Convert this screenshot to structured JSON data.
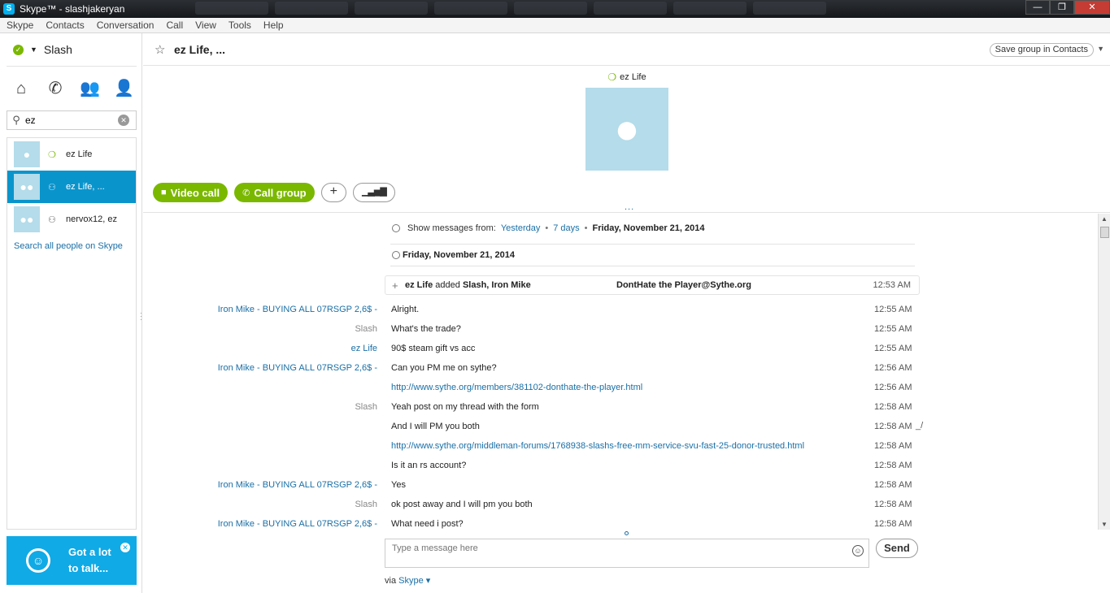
{
  "window": {
    "title": "Skype™ - slashjakeryan",
    "minimize": "—",
    "restore": "❐",
    "close": "✕"
  },
  "menu": [
    "Skype",
    "Contacts",
    "Conversation",
    "Call",
    "View",
    "Tools",
    "Help"
  ],
  "sidebar": {
    "user_name": "Slash",
    "search_value": "ez",
    "contacts": [
      {
        "name": "ez Life",
        "status_icon": "online-leaf-icon",
        "type": "person",
        "selected": false
      },
      {
        "name": "ez Life, ...",
        "status_icon": "group-icon",
        "type": "group",
        "selected": true
      },
      {
        "name": "nervox12, ez",
        "status_icon": "group-icon",
        "type": "group",
        "selected": false
      }
    ],
    "search_all": "Search all people on Skype",
    "ad": {
      "text_line1": "Got a lot",
      "text_line2": "to talk..."
    }
  },
  "conversation": {
    "title": "ez Life, ...",
    "save_group": "Save group in Contacts",
    "profile_name": "ez Life",
    "actions": {
      "video_call": "Video call",
      "call_group": "Call group",
      "add": "+",
      "call_quality": "▁▃▅▇"
    },
    "more": "...",
    "filter": {
      "label": "Show messages from:",
      "yesterday": "Yesterday",
      "seven_days": "7 days",
      "date": "Friday, November 21, 2014"
    },
    "day_header": "Friday, November 21, 2014",
    "event": {
      "actor": "ez Life",
      "verb": "added",
      "targets": "Slash, Iron Mike",
      "group_name": "DontHate the Player@Sythe.org",
      "time": "12:53 AM"
    },
    "messages": [
      {
        "sender": "Iron Mike - BUYING ALL 07RSGP 2,6$ -",
        "sender_style": "blue",
        "text": "Alright.",
        "link": false,
        "time": "12:55 AM",
        "edited": ""
      },
      {
        "sender": "Slash",
        "sender_style": "grey",
        "text": "What's the trade?",
        "link": false,
        "time": "12:55 AM",
        "edited": ""
      },
      {
        "sender": "ez Life",
        "sender_style": "blue",
        "text": "90$ steam gift vs acc",
        "link": false,
        "time": "12:55 AM",
        "edited": ""
      },
      {
        "sender": "Iron Mike - BUYING ALL 07RSGP 2,6$ -",
        "sender_style": "blue",
        "text": "Can you PM me on sythe?",
        "link": false,
        "time": "12:56 AM",
        "edited": ""
      },
      {
        "sender": "",
        "sender_style": "blue",
        "text": "http://www.sythe.org/members/381102-donthate-the-player.html",
        "link": true,
        "time": "12:56 AM",
        "edited": ""
      },
      {
        "sender": "Slash",
        "sender_style": "grey",
        "text": "Yeah post on my thread with the form",
        "link": false,
        "time": "12:58 AM",
        "edited": ""
      },
      {
        "sender": "",
        "sender_style": "grey",
        "text": "And I will PM you both",
        "link": false,
        "time": "12:58 AM",
        "edited": "_/"
      },
      {
        "sender": "",
        "sender_style": "grey",
        "text": "http://www.sythe.org/middleman-forums/1768938-slashs-free-mm-service-svu-fast-25-donor-trusted.html",
        "link": true,
        "time": "12:58 AM",
        "edited": ""
      },
      {
        "sender": "",
        "sender_style": "grey",
        "text": "Is it an rs account?",
        "link": false,
        "time": "12:58 AM",
        "edited": ""
      },
      {
        "sender": "Iron Mike - BUYING ALL 07RSGP 2,6$ -",
        "sender_style": "blue",
        "text": "Yes",
        "link": false,
        "time": "12:58 AM",
        "edited": ""
      },
      {
        "sender": "Slash",
        "sender_style": "grey",
        "text": "ok post away and I will pm you both",
        "link": false,
        "time": "12:58 AM",
        "edited": ""
      },
      {
        "sender": "Iron Mike - BUYING ALL 07RSGP 2,6$ -",
        "sender_style": "blue",
        "text": "What need i post?",
        "link": false,
        "time": "12:58 AM",
        "edited": ""
      }
    ],
    "compose_placeholder": "Type a message here",
    "send": "Send",
    "via_label": "via",
    "via_link": "Skype"
  },
  "colors": {
    "accent_green": "#7ab800",
    "selection_blue": "#0a94cc",
    "link_blue": "#1a6fa6",
    "ad_blue": "#10aae6"
  }
}
